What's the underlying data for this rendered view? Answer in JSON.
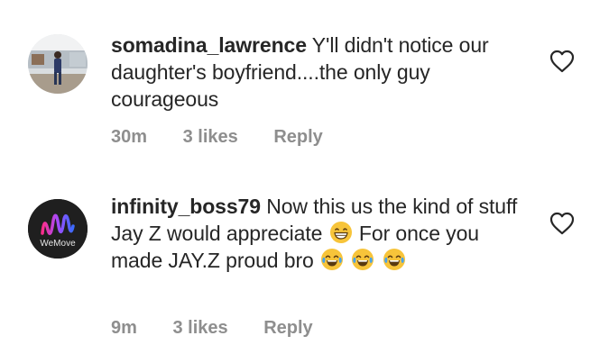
{
  "comments": [
    {
      "username": "somadina_lawrence",
      "text": "Y'll didn't notice our daughter's boyfriend....the only guy courageous",
      "time": "30m",
      "likes": "3 likes",
      "reply_label": "Reply",
      "avatar_icon": "person-photo"
    },
    {
      "username": "infinity_boss79",
      "text_part1": "Now this us the kind of stuff Jay Z would appreciate",
      "text_part2": "For once you made JAY.Z proud bro",
      "time": "9m",
      "likes": "3 likes",
      "reply_label": "Reply",
      "avatar_text": "WeMove",
      "avatar_icon": "wemove-logo",
      "emojis": [
        "grinning-emoji",
        "tears-of-joy-emoji",
        "tears-of-joy-emoji",
        "tears-of-joy-emoji"
      ]
    }
  ],
  "colors": {
    "text": "#262626",
    "meta": "#8e8e8e",
    "emoji": "#f7c43a"
  }
}
